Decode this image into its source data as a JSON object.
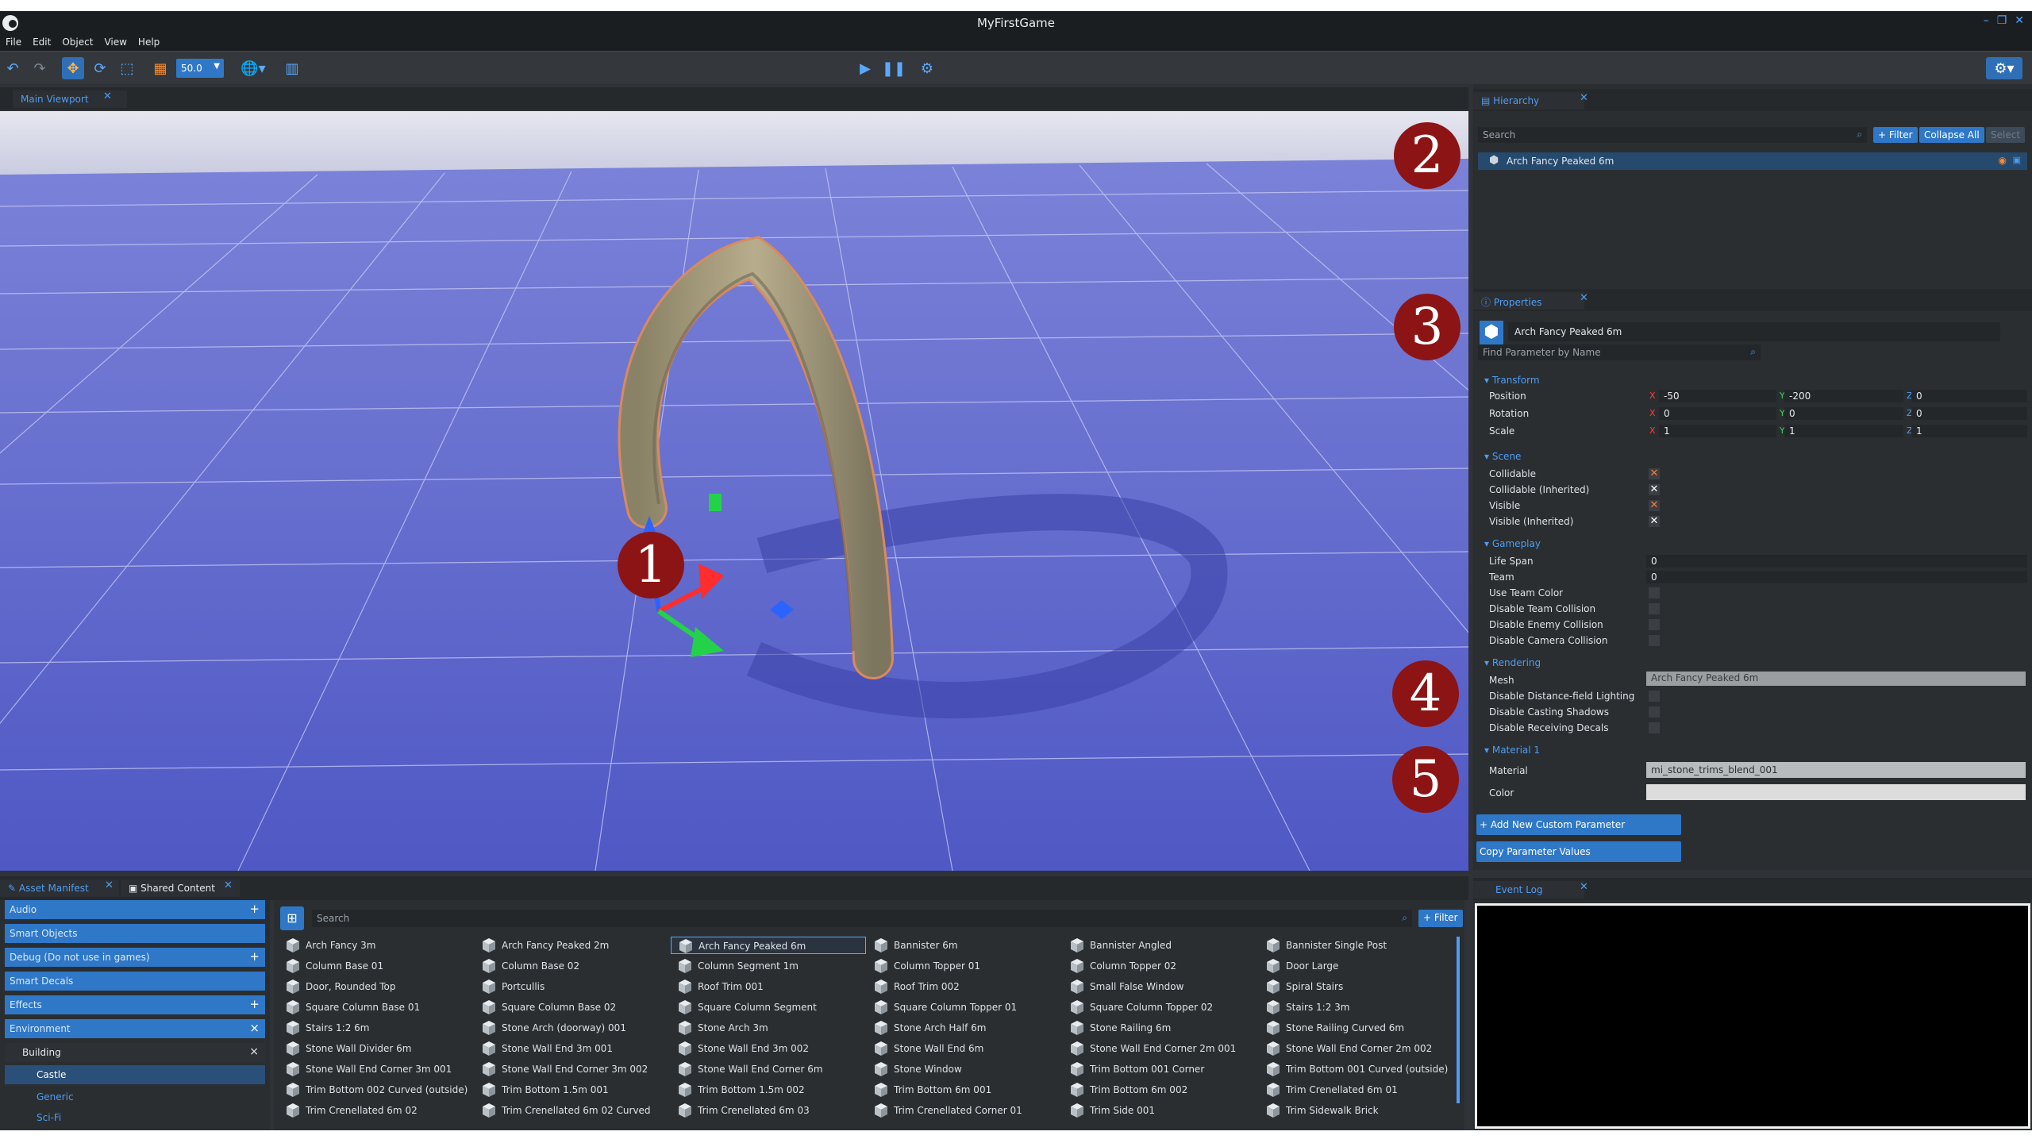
{
  "window": {
    "title": "MyFirstGame",
    "controls": [
      "–",
      "❐",
      "✕"
    ]
  },
  "menu": [
    "File",
    "Edit",
    "Object",
    "View",
    "Help"
  ],
  "toolbar": {
    "zoom_value": "50.0"
  },
  "viewport": {
    "tab_label": "Main Viewport"
  },
  "markers": [
    "1",
    "2",
    "3",
    "4",
    "5"
  ],
  "hierarchy": {
    "tab_label": "Hierarchy",
    "search_placeholder": "Search",
    "filter_label": "+ Filter",
    "collapse_label": "Collapse All",
    "select_label": "Select",
    "item": "Arch Fancy Peaked 6m"
  },
  "properties": {
    "tab_label": "Properties",
    "object_name": "Arch Fancy Peaked 6m",
    "search_placeholder": "Find Parameter by Name",
    "transform": {
      "title": "Transform",
      "position_label": "Position",
      "position": [
        "-50",
        "-200",
        "0"
      ],
      "rotation_label": "Rotation",
      "rotation": [
        "0",
        "0",
        "0"
      ],
      "scale_label": "Scale",
      "scale": [
        "1",
        "1",
        "1"
      ]
    },
    "scene": {
      "title": "Scene",
      "collidable": "Collidable",
      "collidable_inherited": "Collidable (Inherited)",
      "visible": "Visible",
      "visible_inherited": "Visible (Inherited)"
    },
    "gameplay": {
      "title": "Gameplay",
      "life_span_label": "Life Span",
      "life_span": "0",
      "team_label": "Team",
      "team": "0",
      "use_team_color": "Use Team Color",
      "disable_team_collision": "Disable Team Collision",
      "disable_enemy_collision": "Disable Enemy Collision",
      "disable_camera_collision": "Disable Camera Collision"
    },
    "rendering": {
      "title": "Rendering",
      "mesh_label": "Mesh",
      "mesh": "Arch Fancy Peaked 6m",
      "disable_df_lighting": "Disable Distance-field Lighting",
      "disable_casting_shadows": "Disable Casting Shadows",
      "disable_receiving_decals": "Disable Receiving Decals"
    },
    "material1": {
      "title": "Material 1",
      "material_label": "Material",
      "material": "mi_stone_trims_blend_001",
      "color_label": "Color"
    },
    "add_param": "+ Add New Custom Parameter",
    "copy_param": "Copy Parameter Values"
  },
  "event_log": {
    "tab_label": "Event Log"
  },
  "asset_manifest": {
    "tab_label": "Asset Manifest",
    "shared_tab_label": "Shared Content",
    "categories": [
      "Audio",
      "Smart Objects",
      "Debug (Do not use in games)",
      "Smart Decals",
      "Effects",
      "Environment"
    ],
    "subcategories": [
      "Building",
      "Castle",
      "Generic",
      "Sci-Fi"
    ]
  },
  "content": {
    "search_placeholder": "Search",
    "filter_label": "+ Filter",
    "columns": [
      [
        "Arch Fancy 3m",
        "Column Base 01",
        "Door, Rounded Top",
        "Square Column Base 01",
        "Stairs 1:2 6m",
        "Stone Wall Divider 6m",
        "Stone Wall End Corner 3m 001",
        "Trim Bottom 002 Curved (outside)",
        "Trim Crenellated 6m 02"
      ],
      [
        "Arch Fancy Peaked 2m",
        "Column Base 02",
        "Portcullis",
        "Square Column Base 02",
        "Stone Arch (doorway) 001",
        "Stone Wall End 3m 001",
        "Stone Wall End Corner 3m 002",
        "Trim Bottom 1.5m 001",
        "Trim Crenellated 6m 02 Curved"
      ],
      [
        "Arch Fancy Peaked 6m",
        "Column Segment 1m",
        "Roof Trim 001",
        "Square Column Segment",
        "Stone Arch 3m",
        "Stone Wall End 3m 002",
        "Stone Wall End Corner 6m",
        "Trim Bottom 1.5m 002",
        "Trim Crenellated 6m 03"
      ],
      [
        "Bannister 6m",
        "Column Topper 01",
        "Roof Trim 002",
        "Square Column Topper 01",
        "Stone Arch Half 6m",
        "Stone Wall End 6m",
        "Stone Window",
        "Trim Bottom 6m 001",
        "Trim Crenellated Corner 01"
      ],
      [
        "Bannister Angled",
        "Column Topper 02",
        "Small False Window",
        "Square Column Topper 02",
        "Stone Railing 6m",
        "Stone Wall End Corner 2m 001",
        "Trim Bottom 001 Corner",
        "Trim Bottom 6m 002",
        "Trim Side 001"
      ],
      [
        "Bannister Single Post",
        "Door Large",
        "Spiral Stairs",
        "Stairs 1:2 3m",
        "Stone Railing Curved 6m",
        "Stone Wall End Corner 2m 002",
        "Trim Bottom 001 Curved (outside)",
        "Trim Crenellated 6m 01",
        "Trim Sidewalk Brick"
      ]
    ]
  }
}
